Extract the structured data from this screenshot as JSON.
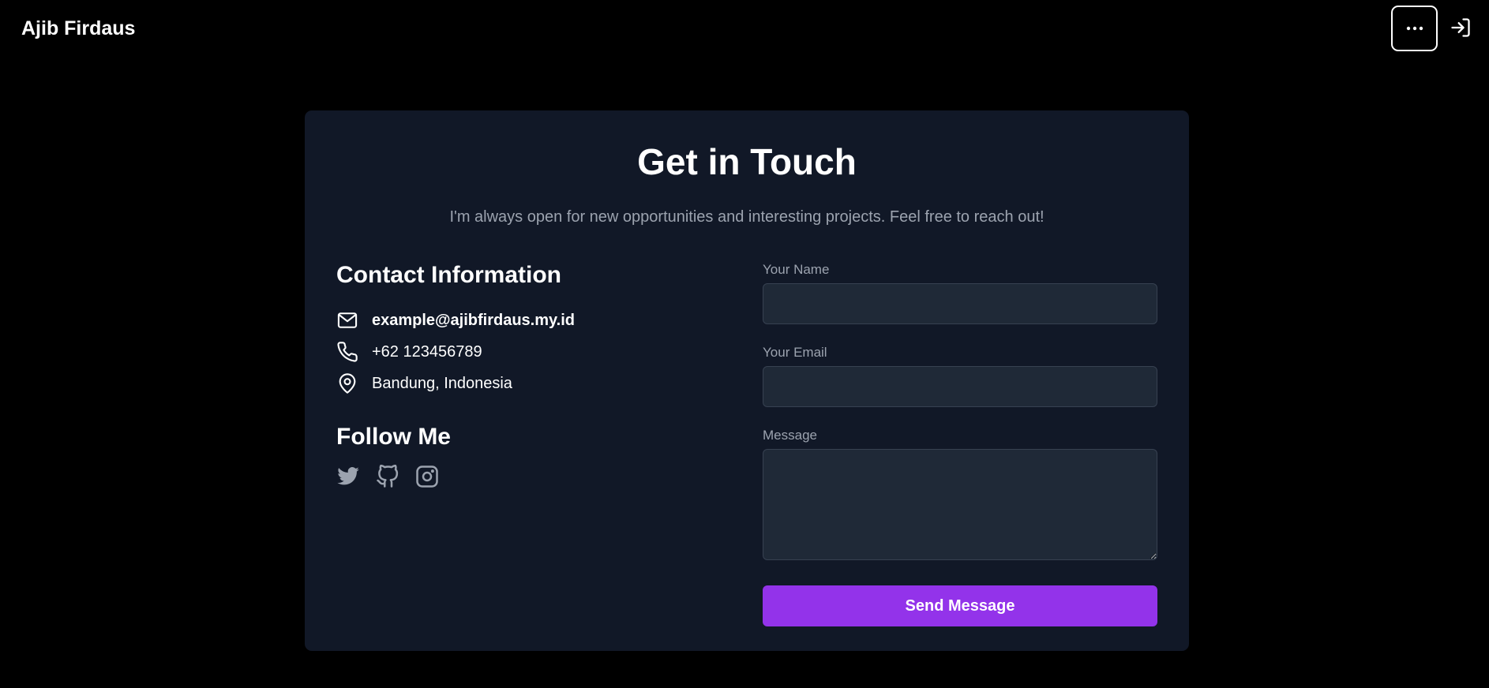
{
  "header": {
    "brand": "Ajib Firdaus",
    "menu_icon": "ellipsis-icon",
    "login_icon": "sign-in-icon"
  },
  "contact_section": {
    "title": "Get in Touch",
    "subtitle": "I'm always open for new opportunities and interesting projects. Feel free to reach out!",
    "info_heading": "Contact Information",
    "email": "example@ajibfirdaus.my.id",
    "phone": "+62 123456789",
    "location": "Bandung, Indonesia",
    "follow_heading": "Follow Me",
    "socials": [
      "twitter-icon",
      "github-icon",
      "instagram-icon"
    ]
  },
  "form": {
    "name_label": "Your Name",
    "name_value": "",
    "email_label": "Your Email",
    "email_value": "",
    "message_label": "Message",
    "message_value": "",
    "submit_label": "Send Message"
  },
  "colors": {
    "page_bg": "#000000",
    "card_bg": "#111827",
    "input_bg": "#1f2937",
    "accent": "#9333ea",
    "muted_text": "#9ca3af"
  }
}
